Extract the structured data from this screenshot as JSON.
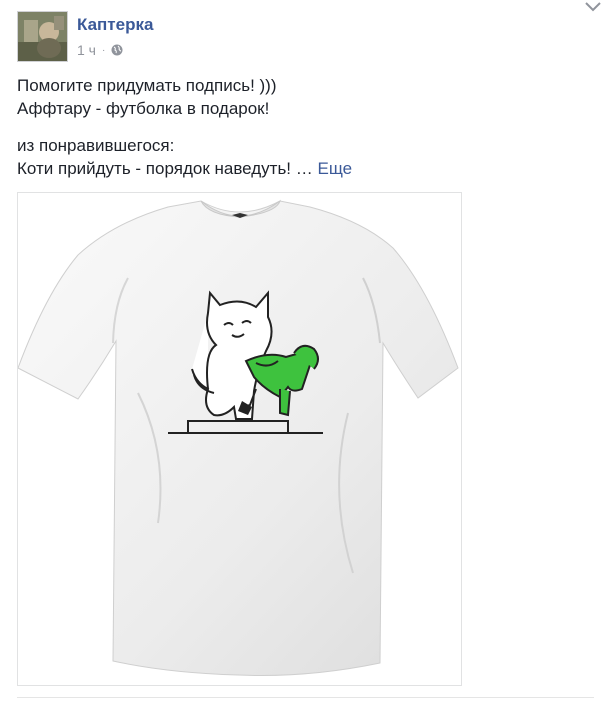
{
  "post": {
    "author": "Каптерка",
    "time": "1 ч",
    "separator": "·",
    "privacy_icon": "globe-icon",
    "menu_icon": "chevron-down-icon",
    "lines": [
      "Помогите придумать подпись! )))",
      "Аффтару - футболка в подарок!",
      "из понравившегося:",
      "Коти прийдуть - порядок наведуть!"
    ],
    "ellipsis": "…",
    "see_more": "Еще",
    "image": {
      "description_icon": "tshirt-with-cat-drawing",
      "colors": {
        "shirt": "#f2f2f2",
        "figure": "#3ec23e",
        "outline": "#222222"
      }
    }
  },
  "colors": {
    "link": "#3b5998",
    "meta": "#90949c",
    "text": "#1d2129"
  }
}
